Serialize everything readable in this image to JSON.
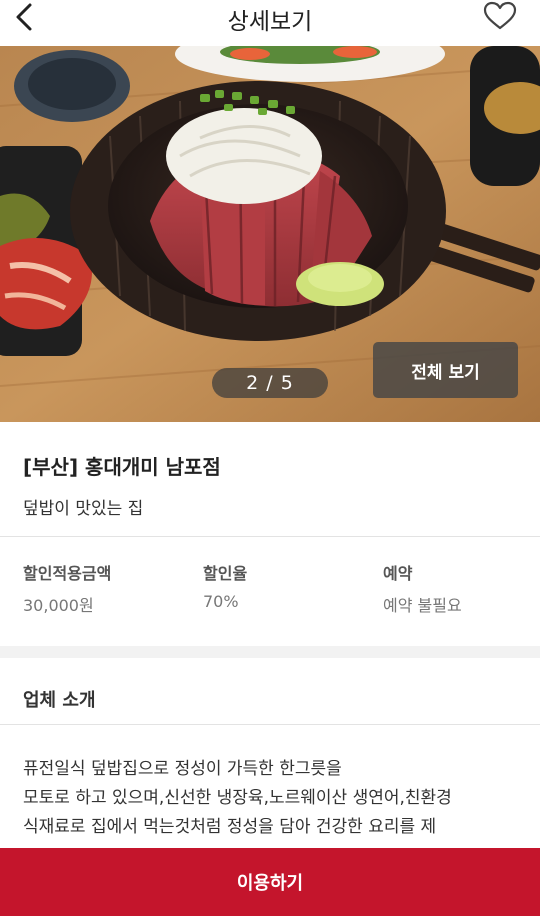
{
  "header": {
    "title": "상세보기",
    "back_icon": "chevron-left-icon",
    "favorite_icon": "heart-outline-icon"
  },
  "gallery": {
    "pager": "2 / 5",
    "view_all_label": "전체 보기"
  },
  "store": {
    "name": "[부산] 홍대개미 남포점",
    "description": "덮밥이 맛있는 집"
  },
  "info": [
    {
      "label": "할인적용금액",
      "value": "30,000원"
    },
    {
      "label": "할인율",
      "value": "70%"
    },
    {
      "label": "예약",
      "value": "예약 불필요"
    }
  ],
  "intro": {
    "title": "업체 소개",
    "lines": [
      "퓨전일식 덮밥집으로 정성이 가득한 한그릇을",
      "모토로 하고 있으며,신선한 냉장육,노르웨이산 생연어,친환경",
      "식재료로 집에서 먹는것처럼 정성을 담아 건강한 요리를 제"
    ]
  },
  "cta": {
    "label": "이용하기"
  },
  "colors": {
    "accent": "#c4152c",
    "background": "#ffffff"
  }
}
